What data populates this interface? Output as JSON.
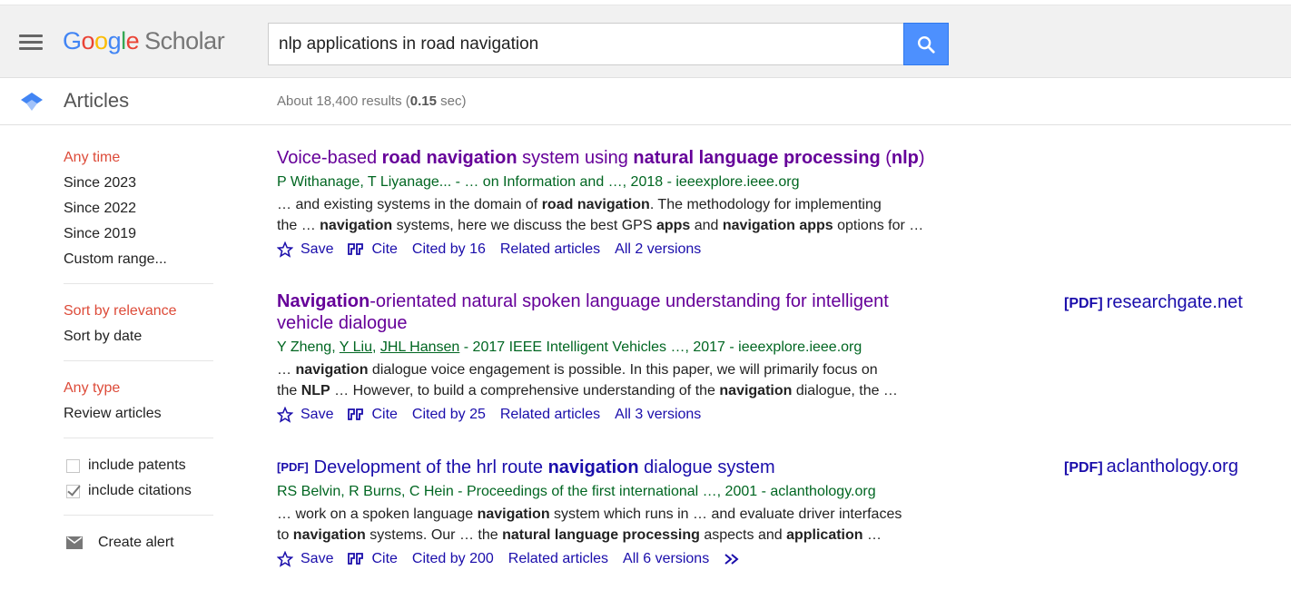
{
  "header": {
    "logo_google": [
      "G",
      "o",
      "o",
      "g",
      "l",
      "e"
    ],
    "logo_scholar": "Scholar",
    "search_value": "nlp applications in road navigation"
  },
  "subbar": {
    "section": "Articles",
    "stats_prefix": "About 18,400 results (",
    "stats_time": "0.15",
    "stats_suffix": " sec)"
  },
  "sidebar": {
    "time_filters": [
      "Any time",
      "Since 2023",
      "Since 2022",
      "Since 2019",
      "Custom range..."
    ],
    "sort_filters": [
      "Sort by relevance",
      "Sort by date"
    ],
    "type_filters": [
      "Any type",
      "Review articles"
    ],
    "include_patents": "include patents",
    "include_citations": "include citations",
    "create_alert": "Create alert"
  },
  "results": [
    {
      "title_parts": [
        "Voice-based ",
        "road navigation",
        " system using ",
        "natural language processing",
        " (",
        "nlp",
        ")"
      ],
      "authors": "P Withanage, T Liyanage... - … on Information and …, 2018 - ieeexplore.ieee.org",
      "snippet1_parts": [
        "… and existing systems in the domain of ",
        "road navigation",
        ". The methodology for implementing"
      ],
      "snippet2_parts": [
        "the … ",
        "navigation",
        " systems, here we discuss the best GPS ",
        "apps",
        " and ",
        "navigation apps",
        " options for …"
      ],
      "save": "Save",
      "cite": "Cite",
      "cited_by": "Cited by 16",
      "related": "Related articles",
      "versions": "All 2 versions"
    },
    {
      "title_parts": [
        "Navigation",
        "-orientated natural spoken language understanding for intelligent vehicle dialogue"
      ],
      "authors_plain1": "Y Zheng, ",
      "authors_link1": "Y Liu",
      "authors_sep": ", ",
      "authors_link2": "JHL Hansen",
      "authors_rest": " - 2017 IEEE Intelligent Vehicles …, 2017 - ieeexplore.ieee.org",
      "snippet1_parts": [
        "… ",
        "navigation",
        " dialogue voice engagement is possible. In this paper, we will primarily focus on"
      ],
      "snippet2_parts": [
        "the ",
        "NLP",
        " … However, to build a comprehensive understanding of the ",
        "navigation",
        " dialogue, the …"
      ],
      "save": "Save",
      "cite": "Cite",
      "cited_by": "Cited by 25",
      "related": "Related articles",
      "versions": "All 3 versions",
      "side_pdf": "[PDF]",
      "side_source": "researchgate.net"
    },
    {
      "pdf_tag": "[PDF]",
      "title_parts": [
        "Development of the hrl route ",
        "navigation",
        " dialogue system"
      ],
      "authors": "RS Belvin, R Burns, C Hein - Proceedings of the first international …, 2001 - aclanthology.org",
      "snippet1_parts": [
        "… work on a spoken language ",
        "navigation",
        " system which runs in … and evaluate driver interfaces"
      ],
      "snippet2_parts": [
        "to ",
        "navigation",
        " systems. Our … the ",
        "natural language processing",
        " aspects and ",
        "application",
        " …"
      ],
      "save": "Save",
      "cite": "Cite",
      "cited_by": "Cited by 200",
      "related": "Related articles",
      "versions": "All 6 versions",
      "side_pdf": "[PDF]",
      "side_source": "aclanthology.org"
    }
  ],
  "colors": {
    "link_blue": "#1a0dab",
    "visited_purple": "#660099",
    "source_green": "#006621",
    "active_red": "#dd4b39",
    "search_button": "#4d90fe"
  },
  "icons": [
    "menu-icon",
    "search-icon",
    "articles-icon",
    "star-icon",
    "quote-icon",
    "more-icon",
    "mail-icon",
    "checkbox-icon"
  ]
}
